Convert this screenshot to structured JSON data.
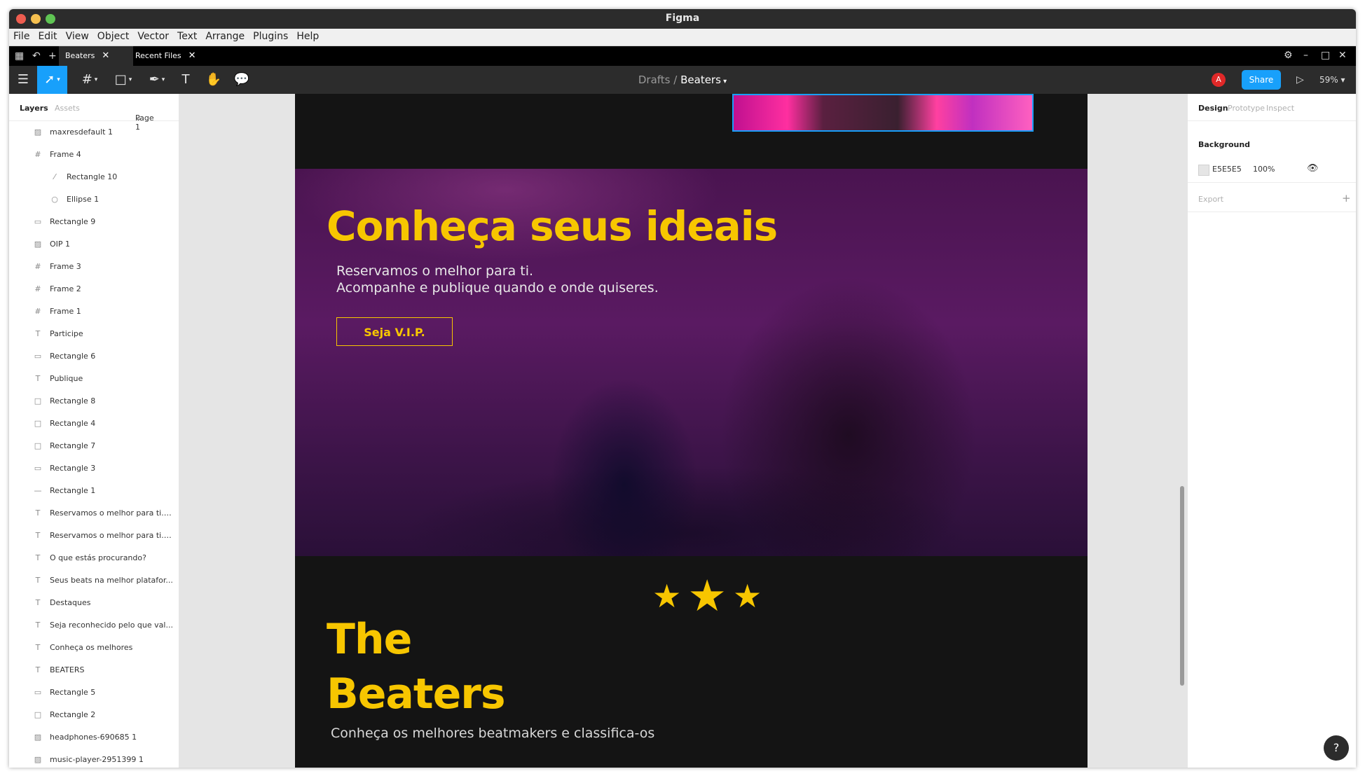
{
  "window": {
    "title": "Figma"
  },
  "menu": [
    "File",
    "Edit",
    "View",
    "Object",
    "Vector",
    "Text",
    "Arrange",
    "Plugins",
    "Help"
  ],
  "tabs": [
    {
      "label": "Beaters"
    },
    {
      "label": "Recent Files"
    }
  ],
  "toolbar": {
    "breadcrumb_parent": "Drafts",
    "breadcrumb_sep": "/",
    "breadcrumb_file": "Beaters",
    "avatar_initial": "A",
    "share_label": "Share",
    "zoom": "59%"
  },
  "left_panel": {
    "tab_layers": "Layers",
    "tab_assets": "Assets",
    "page": "Page 1",
    "layers": [
      {
        "icon": "image-icon",
        "glyph": "▨",
        "name": "maxresdefault 1",
        "indent": 1
      },
      {
        "icon": "frame-icon",
        "glyph": "#",
        "name": "Frame 4",
        "indent": 1
      },
      {
        "icon": "line-icon",
        "glyph": "⁄",
        "name": "Rectangle 10",
        "indent": 2
      },
      {
        "icon": "ellipse-icon",
        "glyph": "○",
        "name": "Ellipse 1",
        "indent": 2
      },
      {
        "icon": "rectangle-icon",
        "glyph": "▭",
        "name": "Rectangle 9",
        "indent": 1
      },
      {
        "icon": "image-icon",
        "glyph": "▨",
        "name": "OIP 1",
        "indent": 1
      },
      {
        "icon": "frame-icon",
        "glyph": "#",
        "name": "Frame 3",
        "indent": 1
      },
      {
        "icon": "frame-icon",
        "glyph": "#",
        "name": "Frame 2",
        "indent": 1
      },
      {
        "icon": "frame-icon",
        "glyph": "#",
        "name": "Frame 1",
        "indent": 1
      },
      {
        "icon": "text-icon",
        "glyph": "T",
        "name": "Participe",
        "indent": 1
      },
      {
        "icon": "rectangle-icon",
        "glyph": "▭",
        "name": "Rectangle 6",
        "indent": 1
      },
      {
        "icon": "text-icon",
        "glyph": "T",
        "name": "Publique",
        "indent": 1
      },
      {
        "icon": "rectangle-icon",
        "glyph": "□",
        "name": "Rectangle 8",
        "indent": 1
      },
      {
        "icon": "rectangle-icon",
        "glyph": "□",
        "name": "Rectangle 4",
        "indent": 1
      },
      {
        "icon": "rectangle-icon",
        "glyph": "□",
        "name": "Rectangle 7",
        "indent": 1
      },
      {
        "icon": "rectangle-icon",
        "glyph": "▭",
        "name": "Rectangle 3",
        "indent": 1
      },
      {
        "icon": "line-icon",
        "glyph": "—",
        "name": "Rectangle 1",
        "indent": 1
      },
      {
        "icon": "text-icon",
        "glyph": "T",
        "name": "Reservamos o melhor para ti. ...",
        "indent": 1
      },
      {
        "icon": "text-icon",
        "glyph": "T",
        "name": "Reservamos o melhor para ti. ...",
        "indent": 1
      },
      {
        "icon": "text-icon",
        "glyph": "T",
        "name": "O que estás procurando?",
        "indent": 1
      },
      {
        "icon": "text-icon",
        "glyph": "T",
        "name": "Seus beats na melhor platafor...",
        "indent": 1
      },
      {
        "icon": "text-icon",
        "glyph": "T",
        "name": "Destaques",
        "indent": 1
      },
      {
        "icon": "text-icon",
        "glyph": "T",
        "name": "Seja reconhecido pelo que val...",
        "indent": 1
      },
      {
        "icon": "text-icon",
        "glyph": "T",
        "name": "Conheça os melhores",
        "indent": 1
      },
      {
        "icon": "text-icon",
        "glyph": "T",
        "name": "BEATERS",
        "indent": 1
      },
      {
        "icon": "rectangle-icon",
        "glyph": "▭",
        "name": "Rectangle 5",
        "indent": 1
      },
      {
        "icon": "rectangle-icon",
        "glyph": "□",
        "name": "Rectangle 2",
        "indent": 1
      },
      {
        "icon": "image-icon",
        "glyph": "▨",
        "name": "headphones-690685 1",
        "indent": 1
      },
      {
        "icon": "image-icon",
        "glyph": "▨",
        "name": "music-player-2951399 1",
        "indent": 1
      }
    ]
  },
  "canvas": {
    "hero_title": "Conheça seus ideais",
    "hero_line1": "Reservamos o melhor para ti.",
    "hero_line2": "Acompanhe e publique quando e onde quiseres.",
    "vip_button": "Seja V.I.P.",
    "beaters_line1": "The",
    "beaters_line2": "Beaters",
    "beaters_sub": "Conheça os melhores beatmakers e classifica-os",
    "accent_color": "#F7C600"
  },
  "right_panel": {
    "tab_design": "Design",
    "tab_prototype": "Prototype",
    "tab_inspect": "Inspect",
    "background_label": "Background",
    "background_hex": "E5E5E5",
    "background_opacity": "100%",
    "export_label": "Export"
  },
  "help_label": "?"
}
